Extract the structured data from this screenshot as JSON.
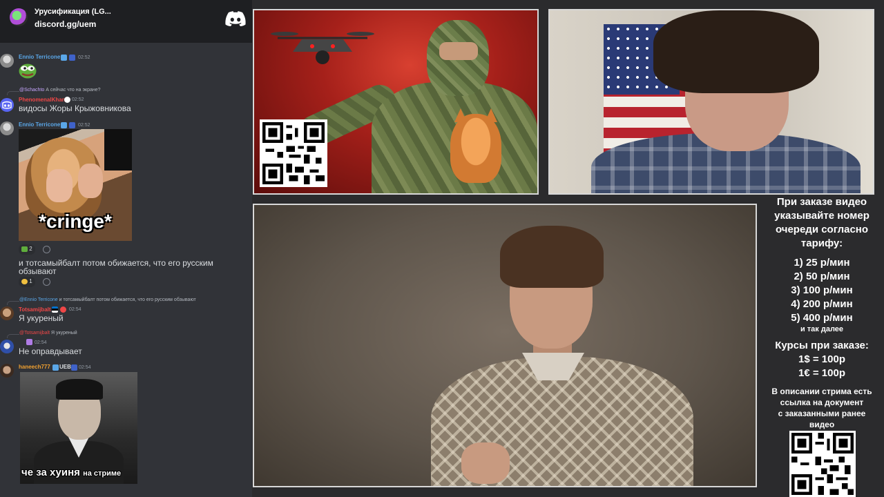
{
  "chat": {
    "server_name": "Урусификация (LG...",
    "server_invite": "discord.gg/uem",
    "messages": [
      {
        "author": "Ennio Terricone",
        "time": "02:52",
        "content": "",
        "attachment": "pepe-emoji"
      },
      {
        "reply_to_author": "@Schachto",
        "reply_to_text": "А сейчас что на экране?",
        "author": "PhenomenalKhan",
        "time": "02:52",
        "content": "видосы Жоры Крыжовникова"
      },
      {
        "author": "Ennio Terricone",
        "time": "02:52",
        "attachment_caption": "*cringe*",
        "reactions": [
          {
            "count": "2"
          }
        ]
      },
      {
        "content_line1": "и тотсамыйбалт потом обижается, что его русским",
        "content_line2": "обзывают",
        "reactions": [
          {
            "count": "1"
          }
        ]
      },
      {
        "reply_to_author": "@Ennio Terricone",
        "reply_to_text": "и тотсамыйбалт потом обижается, что его русским обзывают",
        "author": "Totsamijbalt",
        "time": "02:54",
        "content": "Я укуреный"
      },
      {
        "reply_to_author": "@Totsamijbalt",
        "reply_to_text": "Я укуреный",
        "author": "",
        "time": "02:54",
        "content": "Не оправдывает"
      },
      {
        "author": "haneech777",
        "tag": "UEB",
        "time": "02:54",
        "attachment_caption_big": "че за хуиня",
        "attachment_caption_small": "на стриме"
      }
    ]
  },
  "info": {
    "heading": [
      "При заказе видео",
      "указывайте номер",
      "очереди согласно",
      "тарифу:"
    ],
    "tariffs": [
      "1) 25 р/мин",
      "2) 50 р/мин",
      "3) 100 р/мин",
      "4) 200 р/мин",
      "5) 400 р/мин"
    ],
    "tariffs_more": "и так далее",
    "rates_heading": "Курсы при заказе:",
    "rates": [
      "1$ = 100р",
      "1€ = 100р"
    ],
    "description": [
      "В описании стрима есть",
      "ссылка на документ",
      "с заказанными ранее",
      "видео"
    ]
  },
  "colors": {
    "chat_bg": "#313338",
    "header_bg": "#1e1f22",
    "username_blue": "#5aa7e8",
    "username_red": "#f04747",
    "username_orange": "#f0a030",
    "username_purple": "#b07ce6",
    "page_bg": "#2b2b2d"
  },
  "icons": [
    "discord-logo-icon",
    "server-icon",
    "reaction-add-icon",
    "qr-code-icon"
  ]
}
